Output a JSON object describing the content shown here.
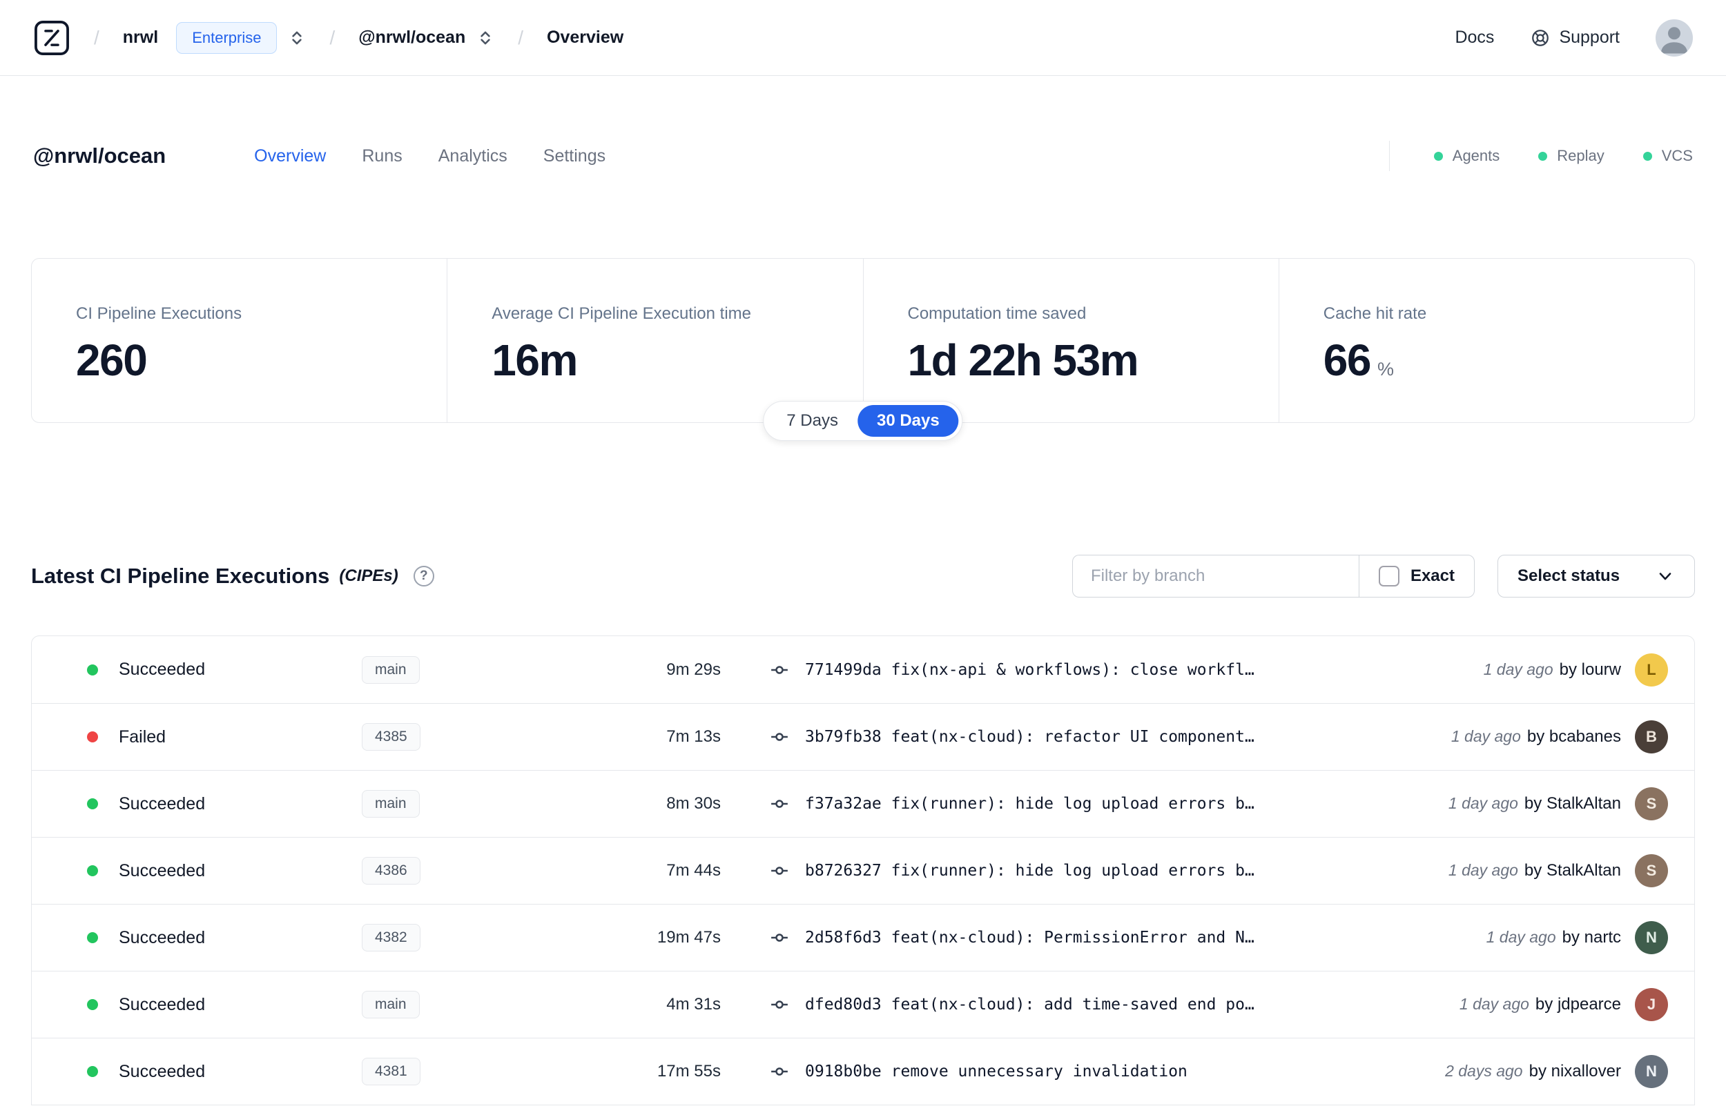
{
  "colors": {
    "accent": "#2563eb",
    "green": "#22c55e",
    "header-green": "#34d399",
    "red": "#ef4444",
    "border": "#e5e7eb",
    "muted": "#6b7280",
    "text": "#111827"
  },
  "navbar": {
    "org": "nrwl",
    "plan_badge": "Enterprise",
    "workspace": "@nrwl/ocean",
    "page": "Overview",
    "docs": "Docs",
    "support": "Support"
  },
  "header": {
    "title": "@nrwl/ocean",
    "tabs": [
      {
        "label": "Overview",
        "active": true
      },
      {
        "label": "Runs",
        "active": false
      },
      {
        "label": "Analytics",
        "active": false
      },
      {
        "label": "Settings",
        "active": false
      }
    ],
    "status_items": [
      "Agents",
      "Replay",
      "VCS"
    ]
  },
  "stats": {
    "cards": [
      {
        "label": "CI Pipeline Executions",
        "value": "260"
      },
      {
        "label": "Average CI Pipeline Execution time",
        "value": "16m"
      },
      {
        "label": "Computation time saved",
        "value": "1d 22h 53m"
      },
      {
        "label": "Cache hit rate",
        "value": "66",
        "unit": "%"
      }
    ],
    "range_toggle": {
      "options": [
        "7 Days",
        "30 Days"
      ],
      "selected": "30 Days"
    }
  },
  "cipe_section": {
    "title": "Latest CI Pipeline Executions",
    "title_suffix": "(CIPEs)",
    "filter_placeholder": "Filter by branch",
    "exact_label": "Exact",
    "status_select": "Select status",
    "rows": [
      {
        "status": "Succeeded",
        "status_color": "green",
        "branch": "main",
        "duration": "9m 29s",
        "commit_hash": "771499da",
        "commit_message": "fix(nx-api & workflows): close workfl…",
        "time_ago": "1 day ago",
        "author": "by lourw",
        "avatar_color": "#f2c94c",
        "avatar_text": "#7a5a00",
        "avatar_initial": "L"
      },
      {
        "status": "Failed",
        "status_color": "red",
        "branch": "4385",
        "duration": "7m 13s",
        "commit_hash": "3b79fb38",
        "commit_message": "feat(nx-cloud): refactor UI component…",
        "time_ago": "1 day ago",
        "author": "by bcabanes",
        "avatar_color": "#4a3f38",
        "avatar_text": "#efe6dc",
        "avatar_initial": "B"
      },
      {
        "status": "Succeeded",
        "status_color": "green",
        "branch": "main",
        "duration": "8m 30s",
        "commit_hash": "f37a32ae",
        "commit_message": "fix(runner): hide log upload errors b…",
        "time_ago": "1 day ago",
        "author": "by StalkAltan",
        "avatar_color": "#8a7260",
        "avatar_text": "#f4ece2",
        "avatar_initial": "S"
      },
      {
        "status": "Succeeded",
        "status_color": "green",
        "branch": "4386",
        "duration": "7m 44s",
        "commit_hash": "b8726327",
        "commit_message": "fix(runner): hide log upload errors b…",
        "time_ago": "1 day ago",
        "author": "by StalkAltan",
        "avatar_color": "#8a7260",
        "avatar_text": "#f4ece2",
        "avatar_initial": "S"
      },
      {
        "status": "Succeeded",
        "status_color": "green",
        "branch": "4382",
        "duration": "19m 47s",
        "commit_hash": "2d58f6d3",
        "commit_message": "feat(nx-cloud): PermissionError and N…",
        "time_ago": "1 day ago",
        "author": "by nartc",
        "avatar_color": "#3f5d4c",
        "avatar_text": "#e3efe7",
        "avatar_initial": "N"
      },
      {
        "status": "Succeeded",
        "status_color": "green",
        "branch": "main",
        "duration": "4m 31s",
        "commit_hash": "dfed80d3",
        "commit_message": "feat(nx-cloud): add time-saved end po…",
        "time_ago": "1 day ago",
        "author": "by jdpearce",
        "avatar_color": "#a8554a",
        "avatar_text": "#f7e7e3",
        "avatar_initial": "J"
      },
      {
        "status": "Succeeded",
        "status_color": "green",
        "branch": "4381",
        "duration": "17m 55s",
        "commit_hash": "0918b0be",
        "commit_message": "remove unnecessary invalidation",
        "time_ago": "2 days ago",
        "author": "by nixallover",
        "avatar_color": "#66707c",
        "avatar_text": "#eef1f5",
        "avatar_initial": "N"
      }
    ]
  }
}
